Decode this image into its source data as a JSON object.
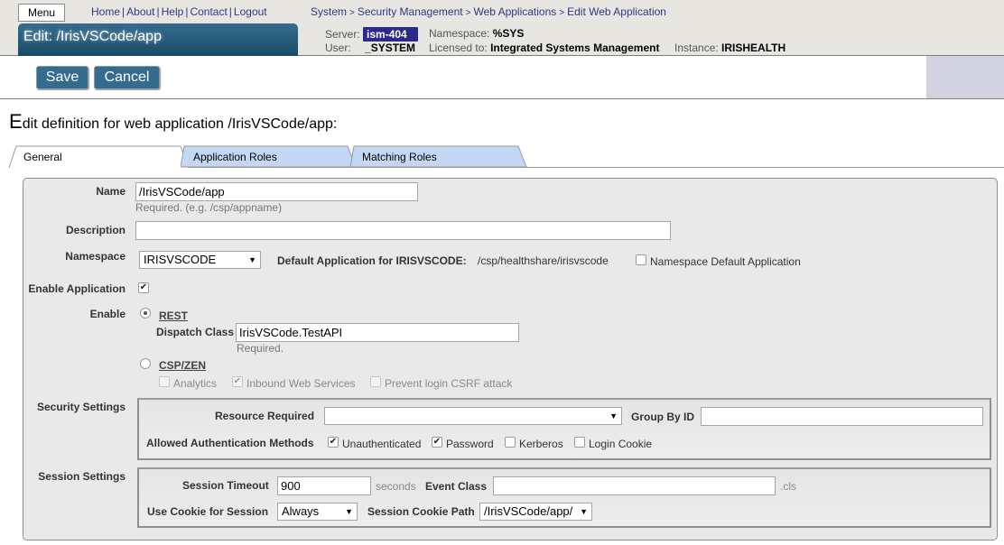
{
  "header": {
    "menu_label": "Menu",
    "links": [
      "Home",
      "About",
      "Help",
      "Contact",
      "Logout"
    ],
    "breadcrumb": [
      "System",
      "Security Management",
      "Web Applications",
      "Edit Web Application"
    ],
    "title": "Edit: /IrisVSCode/app",
    "server_label": "Server:",
    "server_value": "ism-404",
    "namespace_label": "Namespace:",
    "namespace_value": "%SYS",
    "user_label": "User:",
    "user_value": "_SYSTEM",
    "licensed_label": "Licensed to:",
    "licensed_value": "Integrated Systems Management",
    "instance_label": "Instance:",
    "instance_value": "IRISHEALTH"
  },
  "toolbar": {
    "save_label": "Save",
    "cancel_label": "Cancel"
  },
  "page": {
    "title_first_letter": "E",
    "title_rest": "dit definition for web application /IrisVSCode/app:"
  },
  "tabs": [
    {
      "label": "General",
      "active": true
    },
    {
      "label": "Application Roles",
      "active": false
    },
    {
      "label": "Matching Roles",
      "active": false
    }
  ],
  "form": {
    "name_label": "Name",
    "name_value": "/IrisVSCode/app",
    "name_hint": "Required. (e.g. /csp/appname)",
    "description_label": "Description",
    "description_value": "",
    "namespace_label": "Namespace",
    "namespace_value": "IRISVSCODE",
    "default_app_label": "Default Application for IRISVSCODE:",
    "default_app_value": "/csp/healthshare/irisvscode",
    "ns_default_app_label": "Namespace Default Application",
    "ns_default_app_checked": false,
    "enable_app_label": "Enable Application",
    "enable_app_checked": true,
    "enable_label": "Enable",
    "rest_label": "REST",
    "rest_selected": true,
    "dispatch_label": "Dispatch Class",
    "dispatch_value": "IrisVSCode.TestAPI",
    "dispatch_hint": "Required.",
    "cspzen_label": "CSP/ZEN",
    "cspzen_selected": false,
    "analytics_label": "Analytics",
    "analytics_checked": false,
    "inbound_label": "Inbound Web Services",
    "inbound_checked": true,
    "csrf_label": "Prevent login CSRF attack",
    "csrf_checked": false
  },
  "security": {
    "section_label": "Security Settings",
    "resource_label": "Resource Required",
    "resource_value": "",
    "group_label": "Group By ID",
    "group_value": "",
    "auth_label": "Allowed Authentication Methods",
    "methods": [
      {
        "label": "Unauthenticated",
        "checked": true
      },
      {
        "label": "Password",
        "checked": true
      },
      {
        "label": "Kerberos",
        "checked": false
      },
      {
        "label": "Login Cookie",
        "checked": false
      }
    ]
  },
  "session": {
    "section_label": "Session Settings",
    "timeout_label": "Session Timeout",
    "timeout_value": "900",
    "timeout_unit": "seconds",
    "event_class_label": "Event Class",
    "event_class_value": "",
    "event_class_suffix": ".cls",
    "use_cookie_label": "Use Cookie for Session",
    "use_cookie_value": "Always",
    "cookie_path_label": "Session Cookie Path",
    "cookie_path_value": "/IrisVSCode/app/"
  },
  "glyphs": {
    "check": "✔",
    "dropdown": "▼"
  }
}
